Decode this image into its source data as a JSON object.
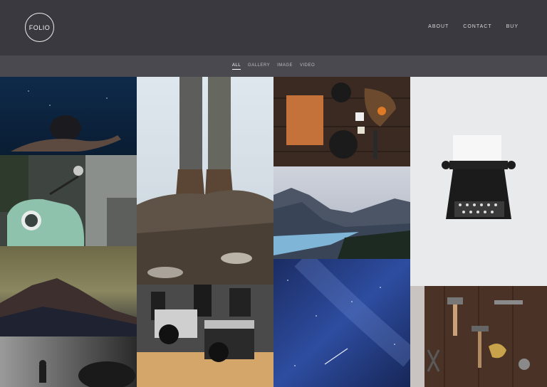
{
  "brand": {
    "logo_text": "FOLIO"
  },
  "nav": {
    "items": [
      "ABOUT",
      "CONTACT",
      "BUY"
    ]
  },
  "filters": {
    "items": [
      "ALL",
      "GALLERY",
      "IMAGE",
      "VIDEO"
    ],
    "active": "ALL"
  },
  "colors": {
    "header_bg": "#3a393f",
    "filter_bg": "#4a4950",
    "text": "#e6e6e6"
  },
  "gallery": {
    "tiles": [
      {
        "name": "swimmer-underwater"
      },
      {
        "name": "green-scooter"
      },
      {
        "name": "mountain-peak-fog"
      },
      {
        "name": "diver-dark"
      },
      {
        "name": "hiker-boots-rocks"
      },
      {
        "name": "vintage-cameras-shelf"
      },
      {
        "name": "desk-flatlay-notebook"
      },
      {
        "name": "mountain-lake"
      },
      {
        "name": "night-sky-stars"
      },
      {
        "name": "typewriter"
      },
      {
        "name": "tools-on-wood"
      }
    ]
  }
}
